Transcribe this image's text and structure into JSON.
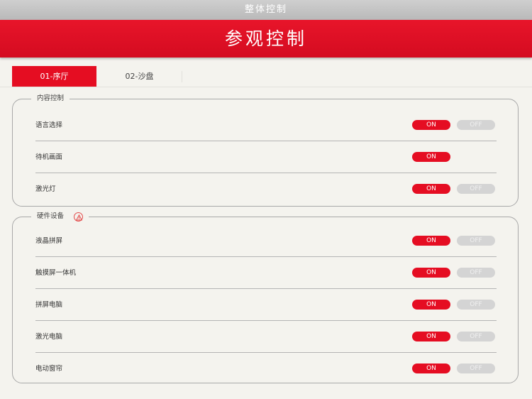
{
  "header": {
    "top_title": "整体控制",
    "main_title": "参观控制"
  },
  "tabs": [
    {
      "label": "01-序厅",
      "active": true
    },
    {
      "label": "02-沙盘",
      "active": false
    }
  ],
  "content_panel": {
    "title": "内容控制",
    "rows": [
      {
        "label": "语言选择",
        "on": "ON",
        "off": "OFF"
      },
      {
        "label": "待机画面",
        "on": "ON"
      },
      {
        "label": "激光灯",
        "on": "ON",
        "off": "OFF"
      }
    ]
  },
  "hardware_panel": {
    "title": "硬件设备",
    "icon": "warning-icon",
    "rows": [
      {
        "label": "液晶拼屏",
        "on": "ON",
        "off": "OFF"
      },
      {
        "label": "触摸屏一体机",
        "on": "ON",
        "off": "OFF"
      },
      {
        "label": "拼屏电脑",
        "on": "ON",
        "off": "OFF"
      },
      {
        "label": "激光电脑",
        "on": "ON",
        "off": "OFF"
      },
      {
        "label": "电动窗帘",
        "on": "ON",
        "off": "OFF"
      }
    ]
  },
  "colors": {
    "accent": "#e50d22",
    "off_button": "#d4d4d4",
    "background": "#f4f3ee"
  }
}
